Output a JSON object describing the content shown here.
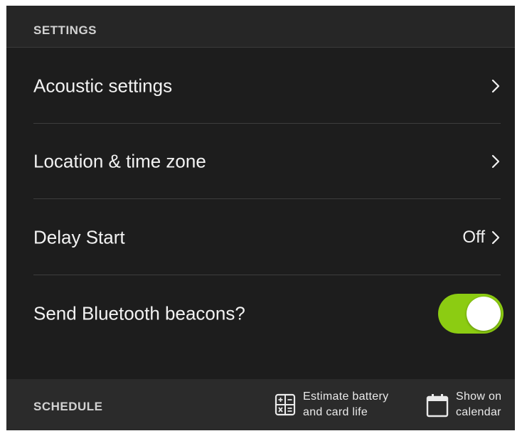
{
  "settings": {
    "header": "SETTINGS",
    "rows": [
      {
        "label": "Acoustic settings",
        "icon": "chevron-right-icon"
      },
      {
        "label": "Location & time zone",
        "icon": "chevron-right-icon"
      },
      {
        "label": "Delay Start",
        "value": "Off",
        "icon": "chevron-right-icon"
      },
      {
        "label": "Send Bluetooth beacons?",
        "toggle_on": true
      }
    ]
  },
  "schedule": {
    "header": "SCHEDULE",
    "actions": [
      {
        "line1": "Estimate battery",
        "line2": "and card life",
        "icon": "calculator-icon"
      },
      {
        "line1": "Show on",
        "line2": "calendar",
        "icon": "calendar-icon"
      }
    ]
  },
  "colors": {
    "background": "#1d1d1d",
    "header_background": "#262626",
    "footer_background": "#2b2b2b",
    "toggle_accent": "#8ccc12",
    "text": "#f2f2f2"
  }
}
